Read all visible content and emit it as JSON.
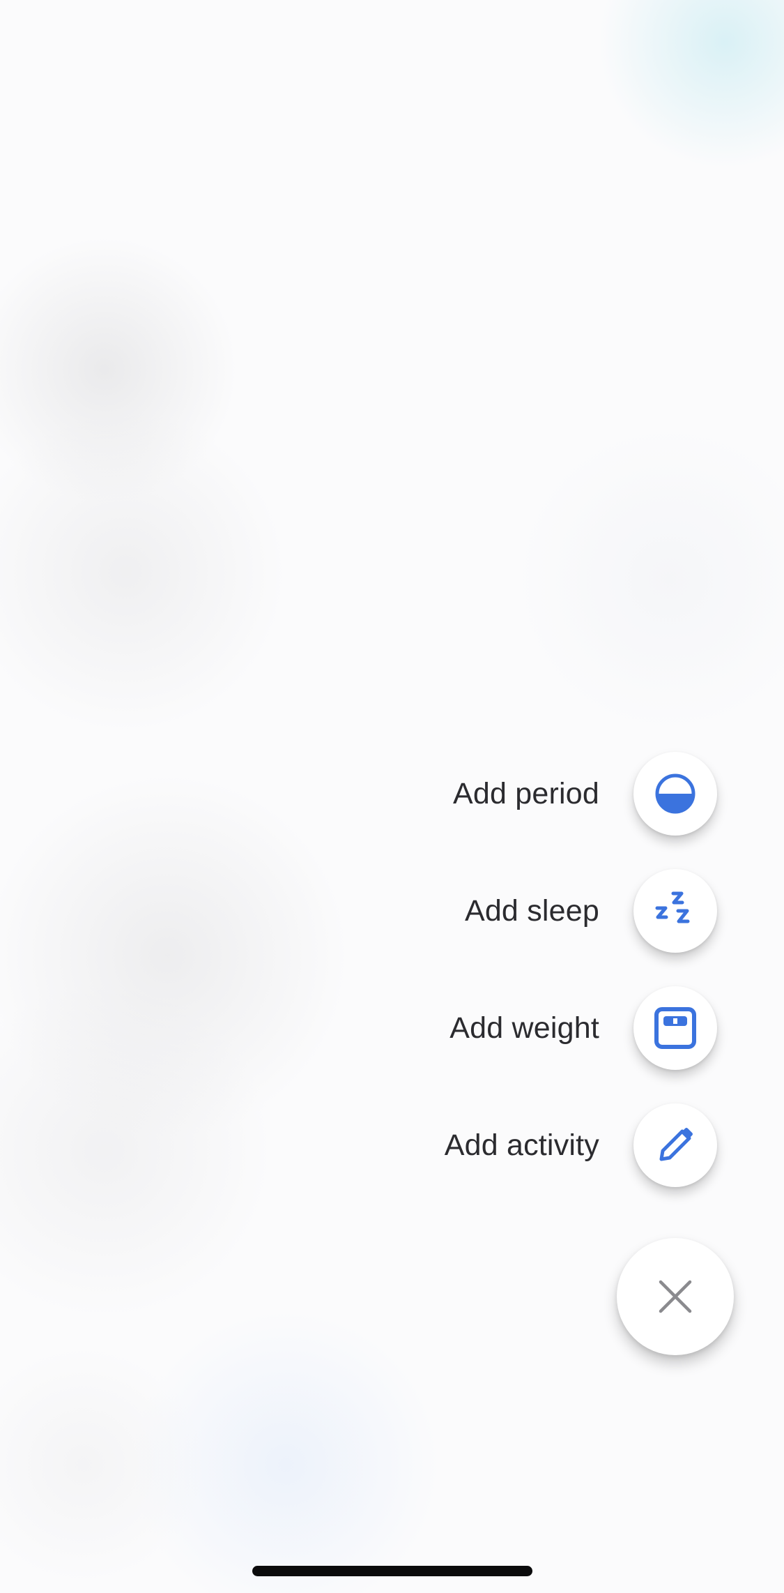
{
  "menu": {
    "items": [
      {
        "label": "Add period",
        "icon": "half-filled-circle-icon"
      },
      {
        "label": "Add sleep",
        "icon": "zzz-sleep-icon"
      },
      {
        "label": "Add weight",
        "icon": "scale-icon"
      },
      {
        "label": "Add activity",
        "icon": "pencil-icon"
      }
    ]
  },
  "fab": {
    "icon": "close-icon"
  },
  "colors": {
    "accent": "#3b73de",
    "label_text": "#2b2b2f",
    "close_icon": "#8a8a8e",
    "fab_background": "#ffffff"
  }
}
